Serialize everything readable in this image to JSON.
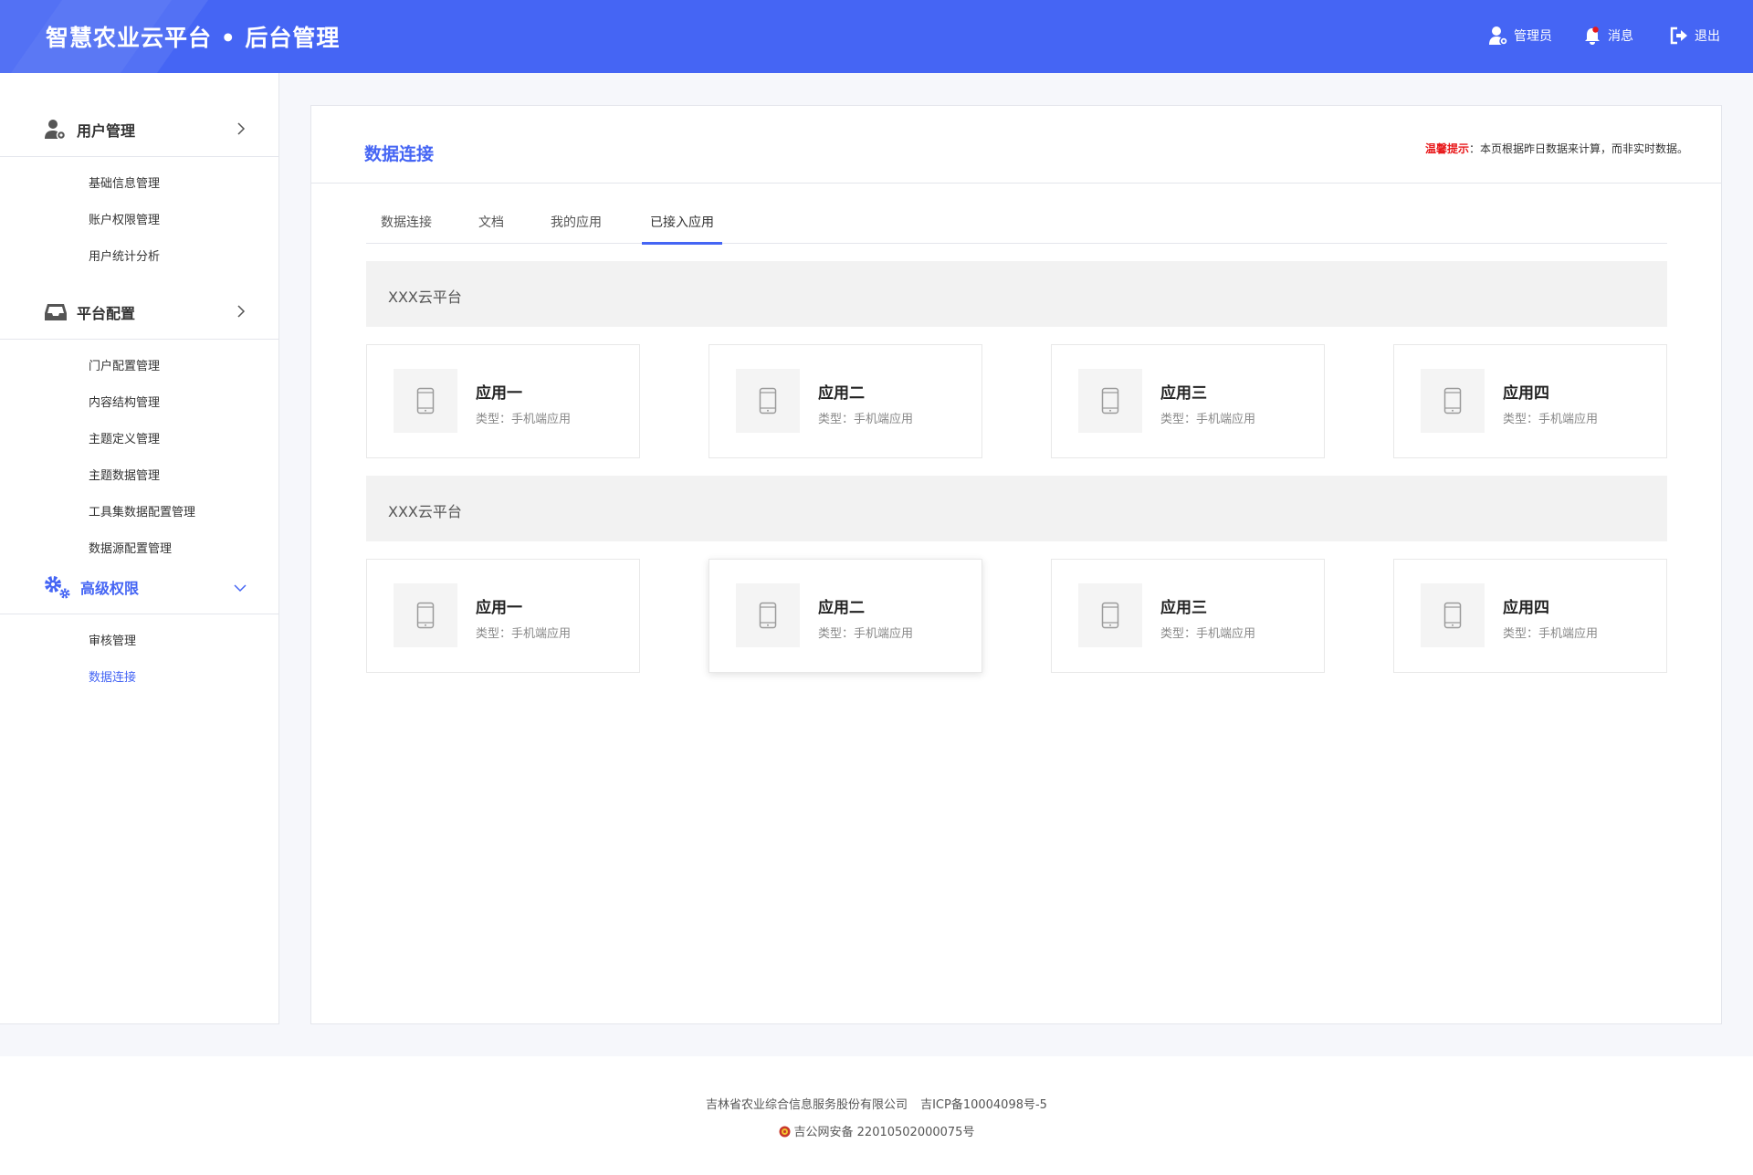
{
  "header": {
    "brand": "智慧农业云平台 • 后台管理",
    "admin_label": "管理员",
    "message_label": "消息",
    "logout_label": "退出"
  },
  "sidebar": {
    "groups": [
      {
        "title": "用户管理",
        "icon": "user-gear-icon",
        "items": [
          "基础信息管理",
          "账户权限管理",
          "用户统计分析"
        ]
      },
      {
        "title": "平台配置",
        "icon": "inbox-icon",
        "items": [
          "门户配置管理",
          "内容结构管理",
          "主题定义管理",
          "主题数据管理",
          "工具集数据配置管理",
          "数据源配置管理"
        ]
      },
      {
        "title": "高级权限",
        "icon": "gears-icon",
        "items": [
          "审核管理",
          "数据连接"
        ],
        "active_item": "数据连接"
      }
    ]
  },
  "main": {
    "title": "数据连接",
    "tip_label": "温馨提示",
    "tip_text": "：本页根据昨日数据来计算，而非实时数据。",
    "tabs": [
      "数据连接",
      "文档",
      "我的应用",
      "已接入应用"
    ],
    "active_tab": "已接入应用",
    "platforms": [
      {
        "name": "XXX云平台",
        "apps": [
          {
            "name": "应用一",
            "type": "类型：手机端应用",
            "icon": "mobile-phone-icon"
          },
          {
            "name": "应用二",
            "type": "类型：手机端应用",
            "icon": "mobile-phone-icon"
          },
          {
            "name": "应用三",
            "type": "类型：手机端应用",
            "icon": "mobile-phone-icon"
          },
          {
            "name": "应用四",
            "type": "类型：手机端应用",
            "icon": "mobile-phone-icon"
          }
        ]
      },
      {
        "name": "XXX云平台",
        "apps": [
          {
            "name": "应用一",
            "type": "类型：手机端应用",
            "icon": "mobile-phone-icon"
          },
          {
            "name": "应用二",
            "type": "类型：手机端应用",
            "icon": "mobile-phone-icon"
          },
          {
            "name": "应用三",
            "type": "类型：手机端应用",
            "icon": "mobile-phone-icon"
          },
          {
            "name": "应用四",
            "type": "类型：手机端应用",
            "icon": "mobile-phone-icon"
          }
        ]
      }
    ]
  },
  "footer": {
    "company": "吉林省农业综合信息服务股份有限公司",
    "icp": "吉ICP备10004098号-5",
    "police": "吉公网安备 22010502000075号"
  },
  "colors": {
    "primary": "#4565f4",
    "tip_red": "#e8191b",
    "group_bar": "#f2f2f2"
  }
}
